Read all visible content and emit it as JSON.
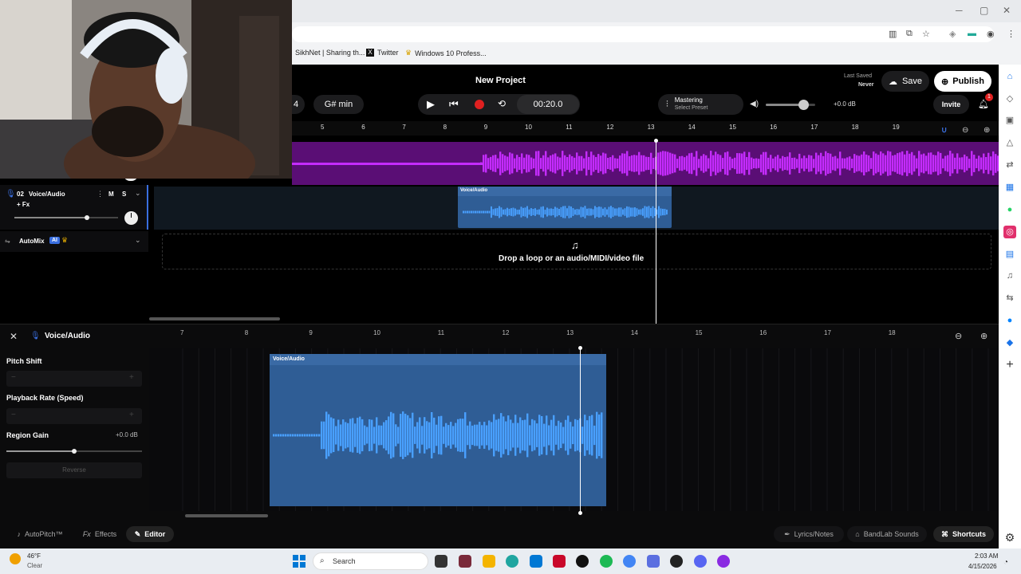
{
  "browser": {
    "bookmarks": [
      "SikhNet | Sharing th...",
      "Twitter",
      "Windows 10 Profess..."
    ]
  },
  "header": {
    "title": "New Project",
    "last_saved_label": "Last Saved",
    "last_saved_value": "Never",
    "save_label": "Save",
    "publish_label": "Publish",
    "invite_label": "Invite",
    "notification_count": "1"
  },
  "transport": {
    "bar_count": "4",
    "key": "G# min",
    "time": "00:20.0",
    "mastering_label": "Mastering",
    "preset_label": "Select Preset",
    "master_gain": "+0.0 dB",
    "master_volume_level": 0.75
  },
  "ruler_top": [
    "5",
    "6",
    "7",
    "8",
    "9",
    "10",
    "11",
    "12",
    "13",
    "14",
    "15",
    "16",
    "17",
    "18",
    "19"
  ],
  "tracks": [
    {
      "number": "02",
      "name": "Voice/Audio",
      "fx_label": "+ Fx",
      "mute": "M",
      "solo": "S",
      "volume_level": 0.7,
      "region_label": "Voice/Audio"
    }
  ],
  "automix": {
    "label": "AutoMix",
    "badge": "AI"
  },
  "dropzone": {
    "text": "Drop a loop or an audio/MIDI/video file"
  },
  "editor": {
    "title": "Voice/Audio",
    "ruler": [
      "7",
      "8",
      "9",
      "10",
      "11",
      "12",
      "13",
      "14",
      "15",
      "16",
      "17",
      "18"
    ],
    "region_label": "Voice/Audio",
    "pitch_shift_label": "Pitch Shift",
    "playback_rate_label": "Playback Rate (Speed)",
    "region_gain_label": "Region Gain",
    "region_gain_value": "+0.0 dB",
    "region_gain_level": 0.5,
    "reverse_label": "Reverse"
  },
  "bottom_bar": {
    "autopitch": "AutoPitch™",
    "effects": "Effects",
    "editor": "Editor",
    "lyrics": "Lyrics/Notes",
    "sounds": "BandLab Sounds",
    "shortcuts": "Shortcuts"
  },
  "taskbar": {
    "weather_temp": "46°F",
    "weather_desc": "Clear",
    "search_placeholder": "Search",
    "time": "2:03 AM",
    "date": "4/15/2026"
  }
}
